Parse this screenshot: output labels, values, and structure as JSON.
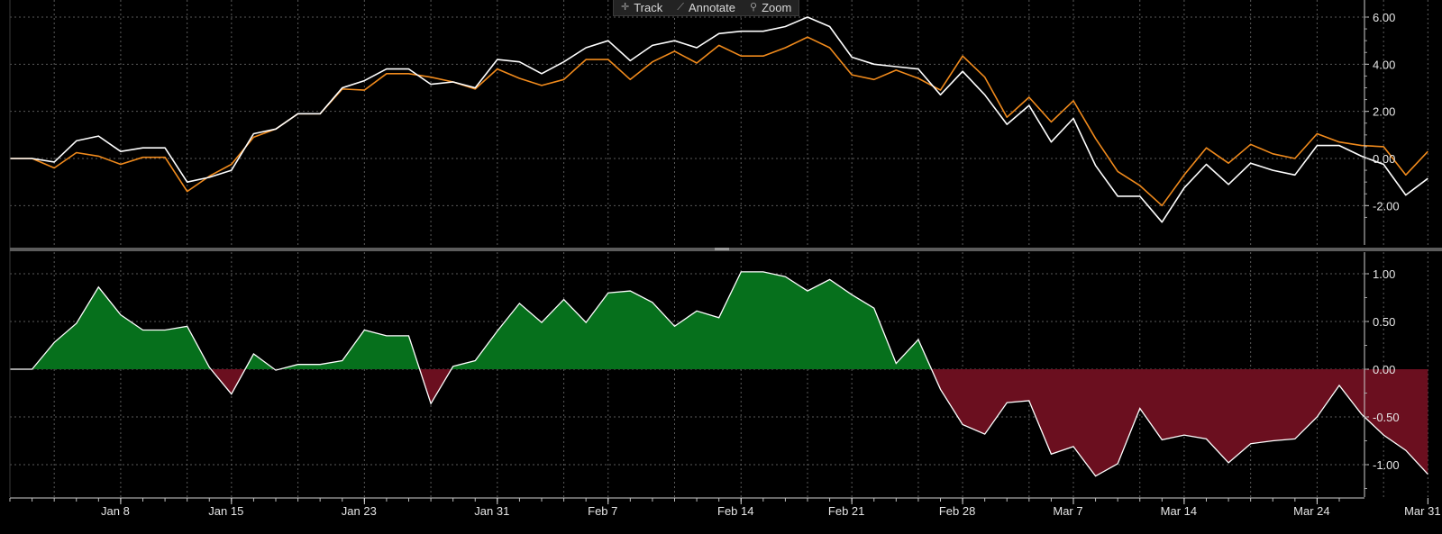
{
  "toolbar": {
    "track_label": "Track",
    "annotate_label": "Annotate",
    "zoom_label": "Zoom"
  },
  "colors": {
    "background": "#000000",
    "grid": "#5a5a5a",
    "series_white": "#ffffff",
    "series_orange": "#f08a1c",
    "positive_fill": "#06701c",
    "negative_fill": "#6b0f1f",
    "divider": "#5c5c5c"
  },
  "chart_data": [
    {
      "type": "line",
      "panel": "top",
      "ylim": [
        -2.8,
        6.3
      ],
      "yticks": [
        -2,
        0,
        2,
        4,
        6
      ],
      "ytick_labels": [
        "-2.00",
        "0.00",
        "2.00",
        "4.00",
        "6.00"
      ],
      "grid": true,
      "x": [
        "Jan 2",
        "Jan 3",
        "Jan 6",
        "Jan 7",
        "Jan 8",
        "Jan 9",
        "Jan 10",
        "Jan 13",
        "Jan 14",
        "Jan 15",
        "Jan 16",
        "Jan 17",
        "Jan 21",
        "Jan 22",
        "Jan 23",
        "Jan 24",
        "Jan 27",
        "Jan 28",
        "Jan 29",
        "Jan 30",
        "Jan 31",
        "Feb 3",
        "Feb 4",
        "Feb 5",
        "Feb 6",
        "Feb 7",
        "Feb 10",
        "Feb 11",
        "Feb 12",
        "Feb 13",
        "Feb 14",
        "Feb 18",
        "Feb 19",
        "Feb 20",
        "Feb 21",
        "Feb 24",
        "Feb 25",
        "Feb 26",
        "Feb 27",
        "Feb 28",
        "Mar 3",
        "Mar 4",
        "Mar 5",
        "Mar 6",
        "Mar 7",
        "Mar 10",
        "Mar 11",
        "Mar 12",
        "Mar 13",
        "Mar 14",
        "Mar 17",
        "Mar 18",
        "Mar 19",
        "Mar 20",
        "Mar 21",
        "Mar 24",
        "Mar 25",
        "Mar 26",
        "Mar 27",
        "Mar 28",
        "Mar 31"
      ],
      "series": [
        {
          "color": "#ffffff",
          "values": [
            0.0,
            0.0,
            -0.15,
            0.75,
            0.95,
            0.3,
            0.45,
            0.45,
            -1.0,
            -0.8,
            -0.5,
            1.05,
            1.25,
            1.9,
            1.9,
            3.0,
            3.3,
            3.8,
            3.8,
            3.15,
            3.25,
            3.0,
            4.2,
            4.1,
            3.6,
            4.1,
            4.7,
            5.0,
            4.15,
            4.8,
            5.0,
            4.7,
            5.3,
            5.4,
            5.4,
            5.6,
            6.0,
            5.6,
            4.3,
            4.0,
            3.9,
            3.8,
            2.7,
            3.7,
            2.7,
            1.45,
            2.25,
            0.7,
            1.7,
            -0.3,
            -1.6,
            -1.6,
            -2.7,
            -1.25,
            -0.25,
            -1.1,
            -0.2,
            -0.5,
            -0.7,
            0.55,
            0.55,
            0.1,
            -0.25,
            -1.55,
            -0.85
          ]
        },
        {
          "color": "#f08a1c",
          "values": [
            0.0,
            0.0,
            -0.4,
            0.25,
            0.1,
            -0.25,
            0.05,
            0.05,
            -1.4,
            -0.75,
            -0.25,
            0.9,
            1.25,
            1.9,
            1.9,
            2.95,
            2.9,
            3.6,
            3.6,
            3.45,
            3.25,
            2.95,
            3.8,
            3.4,
            3.1,
            3.35,
            4.2,
            4.2,
            3.35,
            4.1,
            4.55,
            4.05,
            4.8,
            4.35,
            4.35,
            4.7,
            5.15,
            4.7,
            3.55,
            3.35,
            3.75,
            3.4,
            2.9,
            4.35,
            3.45,
            1.75,
            2.6,
            1.55,
            2.45,
            0.85,
            -0.55,
            -1.15,
            -2.0,
            -0.7,
            0.45,
            -0.2,
            0.6,
            0.2,
            0.0,
            1.05,
            0.7,
            0.55,
            0.5,
            -0.7,
            0.3
          ]
        }
      ]
    },
    {
      "type": "area",
      "panel": "bottom",
      "ylim": [
        -1.33,
        1.25
      ],
      "yticks": [
        1,
        0.5,
        0,
        -0.5,
        -1
      ],
      "ytick_labels": [
        "1.00",
        "0.50",
        "0.00",
        "-0.50",
        "-1.00"
      ],
      "grid": true,
      "x_tick_labels": [
        "Jan 8",
        "Jan 15",
        "Jan 23",
        "Jan 31",
        "Feb 7",
        "Feb 14",
        "Feb 21",
        "Feb 28",
        "Mar 7",
        "Mar 14",
        "Mar 24",
        "Mar 31"
      ],
      "x_tick_index": [
        5,
        10,
        16,
        22,
        27,
        33,
        38,
        43,
        48,
        53,
        59,
        64
      ],
      "values": [
        0.0,
        0.0,
        0.28,
        0.48,
        0.86,
        0.57,
        0.41,
        0.41,
        0.45,
        0.02,
        -0.26,
        0.16,
        -0.01,
        0.05,
        0.05,
        0.09,
        0.41,
        0.35,
        0.35,
        -0.36,
        0.03,
        0.09,
        0.4,
        0.69,
        0.49,
        0.73,
        0.49,
        0.8,
        0.82,
        0.7,
        0.45,
        0.61,
        0.54,
        1.02,
        1.02,
        0.97,
        0.82,
        0.94,
        0.78,
        0.64,
        0.06,
        0.31,
        -0.21,
        -0.58,
        -0.68,
        -0.35,
        -0.33,
        -0.89,
        -0.81,
        -1.12,
        -0.99,
        -0.41,
        -0.74,
        -0.69,
        -0.73,
        -0.98,
        -0.78,
        -0.75,
        -0.73,
        -0.5,
        -0.17,
        -0.47,
        -0.69,
        -0.85,
        -1.1
      ]
    }
  ]
}
